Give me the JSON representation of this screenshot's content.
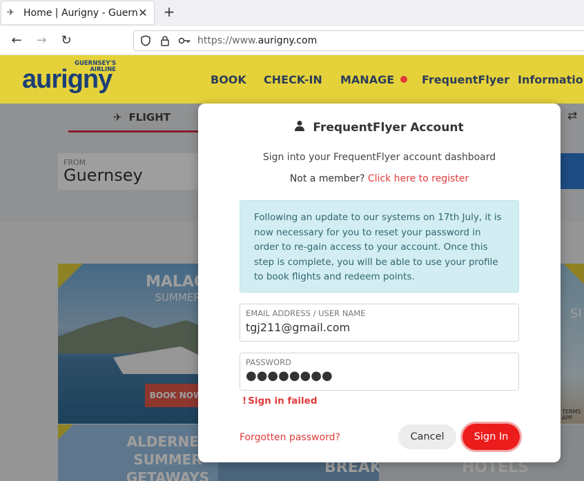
{
  "browser": {
    "tab_title": "Home | Aurigny - Guernsey",
    "tab_icon": "plane-icon",
    "new_tab_label": "+",
    "url_prefix": "https://www.",
    "url_host": "aurigny.com"
  },
  "site": {
    "logo_small": "GUERNSEY'S AIRLINE",
    "logo_big": "aurigny",
    "nav": [
      {
        "label": "BOOK"
      },
      {
        "label": "CHECK-IN"
      },
      {
        "label": "MANAGE"
      },
      {
        "label": "FrequentFlyer"
      },
      {
        "label": "Information"
      }
    ],
    "colors": {
      "header": "#e5d23b",
      "accent": "#e03a3a",
      "brand": "#1c3f78"
    }
  },
  "booking": {
    "flight_tab": "FLIGHT",
    "from_label": "FROM",
    "from_value": "Guernsey"
  },
  "promos": {
    "malaga_title": "MALAGA",
    "malaga_sub": "SUMMER SU",
    "malaga_button": "BOOK NOW",
    "right_title": "SI",
    "right_small": "TERMS APP",
    "alderney": "ALDERNEY SUMMER GETAWAYS",
    "breaks": "BREAKS",
    "hotels": "HOTELS"
  },
  "modal": {
    "title": "FrequentFlyer Account",
    "subtitle": "Sign into your FrequentFlyer account dashboard",
    "not_member": "Not a member?",
    "register_link": "Click here to register",
    "notice": "Following an update to our systems on 17th July, it is now necessary for you to reset your password in order to re-gain access to your account. Once this step is complete, you will be able to use your profile to book flights and redeem points.",
    "email_label": "EMAIL ADDRESS / USER NAME",
    "email_value": "tgj211@gmail.com",
    "password_label": "PASSWORD",
    "password_value": "●●●●●●●●",
    "error_icon": "!",
    "error": "Sign in failed",
    "forgot_link": "Forgotten password?",
    "cancel": "Cancel",
    "signin": "Sign In"
  }
}
